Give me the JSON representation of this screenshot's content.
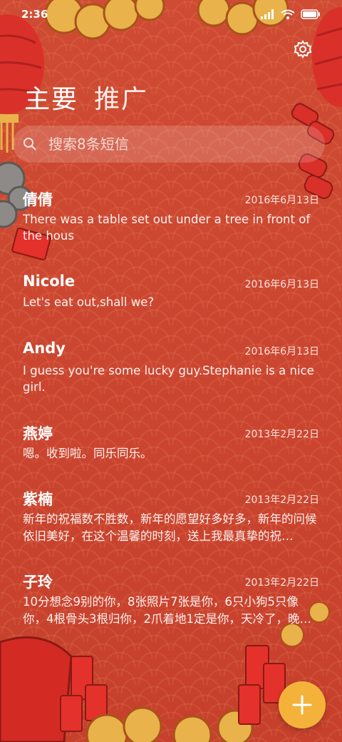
{
  "status_bar": {
    "time": "2:36"
  },
  "header": {
    "tabs": [
      "主要",
      "推广"
    ]
  },
  "search": {
    "placeholder": "搜索8条短信"
  },
  "messages": [
    {
      "name": "倩倩",
      "date": "2016年6月13日",
      "snippet": "There was a table set out under a tree in front of the hous"
    },
    {
      "name": "Nicole",
      "date": "2016年6月13日",
      "snippet": "Let's eat out,shall we?"
    },
    {
      "name": "Andy",
      "date": "2016年6月13日",
      "snippet": "I guess you're some lucky guy.Stephanie is a nice girl."
    },
    {
      "name": "燕婷",
      "date": "2013年2月22日",
      "snippet": "嗯。收到啦。同乐同乐。"
    },
    {
      "name": "紫楠",
      "date": "2013年2月22日",
      "snippet": "新年的祝福数不胜数，新年的愿望好多好多，新年的问候依旧美好，在这个温馨的时刻，送上我最真挚的祝…"
    },
    {
      "name": "子玲",
      "date": "2013年2月22日",
      "snippet": "10分想念9别的你，8张照片7张是你，6只小狗5只像你，4根骨头3根归你，2爪着地1定是你，天冷了，晚…"
    }
  ],
  "colors": {
    "background": "#c9432f",
    "fab": "#f4b23a",
    "lantern": "#d9302a",
    "gold": "#e9b24a"
  },
  "icons": {
    "settings": "gear-icon",
    "search": "search-icon",
    "compose": "plus-icon"
  }
}
